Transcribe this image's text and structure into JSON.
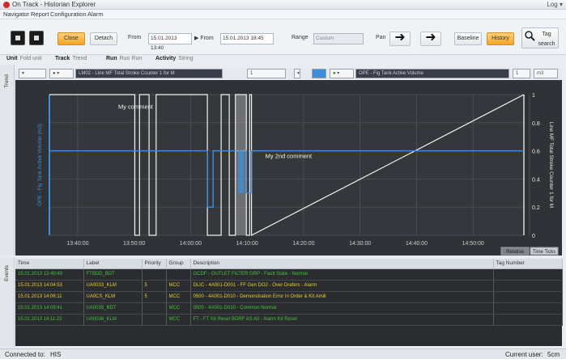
{
  "app": {
    "title": "On Track - Historian Explorer",
    "window_controls": "Log ▾"
  },
  "menu": [
    "Navigator",
    "Report",
    "Configuration",
    "Alarm"
  ],
  "toolbar": {
    "close_label": "Close",
    "detach_label": "Detach",
    "from_label": "From",
    "from_value": "15.01.2013 13:40",
    "to_label": "▶ From",
    "to_value": "15.01.2013 18:45",
    "range_label": "Range",
    "range_value": "Custom",
    "pan_label": "Pan",
    "baseline_label": "Baseline",
    "history_label": "History",
    "tag_search_label": "Tag search"
  },
  "subtoolbar": [
    {
      "label": "Unit",
      "value": "Fold unit"
    },
    {
      "label": "Track",
      "value": "Trend"
    },
    {
      "label": "Run",
      "value": "Run Run"
    },
    {
      "label": "Activity",
      "value": "String"
    }
  ],
  "strips": {
    "trend": "Trend",
    "events": "Events"
  },
  "selectors": {
    "pen1": "LM02 - Line MF Total Stroke Counter 1 for M",
    "pen1_num": "1",
    "pen2": "OPE - Fig Tank Active Volume",
    "pen2_num": "1",
    "pen2_unit": "m3"
  },
  "colors": {
    "accent": "#f4a42a",
    "series_blue": "#3d8fdc",
    "series_white": "#f2f2f2",
    "chart_bg": "#2f3236",
    "event_green": "#46c03a",
    "event_yellow": "#e6cf2a"
  },
  "chart_data": {
    "type": "line",
    "x_ticks": [
      "13:40:00",
      "13:50:00",
      "14:00:00",
      "14:10:00",
      "14:20:00",
      "14:30:00",
      "14:40:00",
      "14:50:00"
    ],
    "yleft_label": "OPE - Fig Tank Active Volume (m3)",
    "yright_label": "Line MF Total Stroke Counter 1 for M",
    "yright_ticks": [
      "1",
      "0.8",
      "0.6",
      "0.4",
      "0.2",
      "0"
    ],
    "ylim_right": [
      0,
      1
    ],
    "series": [
      {
        "name": "Line MF Total Stroke Counter 1 for M",
        "color": "#f2f2f2",
        "x": [
          0.0,
          0.18,
          0.18,
          0.19,
          0.19,
          0.21,
          0.21,
          0.225,
          0.225,
          0.333,
          0.333,
          0.362,
          0.362,
          0.379,
          0.379,
          0.392,
          0.392,
          0.415,
          0.415,
          0.422,
          0.422,
          0.426,
          0.426,
          1.0
        ],
        "values": [
          1,
          1,
          0,
          0,
          1,
          1,
          0,
          0,
          1,
          1,
          0,
          0,
          1,
          1,
          0,
          0,
          1,
          1,
          0,
          0,
          1,
          1,
          0,
          1
        ]
      },
      {
        "name": "Fig Tank Active Volume",
        "color": "#3d8fdc",
        "x": [
          0.0,
          0.333,
          0.333,
          0.345,
          0.345,
          0.415,
          0.415,
          0.425,
          0.425,
          1.0
        ],
        "values": [
          0.6,
          0.6,
          0.2,
          0.2,
          0.6,
          0.6,
          0.3,
          0.3,
          0.6,
          0.6
        ]
      }
    ],
    "annotations": [
      {
        "text": "My comment",
        "x": 0.145,
        "y": 0.9
      },
      {
        "text": "My 2nd comment",
        "x": 0.455,
        "y": 0.55
      }
    ],
    "grid": true,
    "bottom_tabs": [
      "Relative",
      "Time Ticks"
    ]
  },
  "events": {
    "columns": [
      "Time",
      "Label",
      "Priority",
      "Group",
      "Description",
      "Tag Number"
    ],
    "rows": [
      {
        "cells": [
          "15.01.2013 13:49:49",
          "FTBDD_BDT",
          "",
          "",
          "GCDF - OUTLET FILTER GRP - Fault State - Normal",
          ""
        ],
        "color": "#46c03a"
      },
      {
        "cells": [
          "15.01.2013 14:04:53",
          "UA0033_KLM",
          "5",
          "MCC",
          "DLIC - 4A001-D001 - FF Gen DO2 - Over Drafers - Alarm",
          ""
        ],
        "color": "#e6cf2a"
      },
      {
        "cells": [
          "15.01.2013 14:06:11",
          "UA0CS_KLM",
          "5",
          "MCC",
          "0500 - 4A001-D010 - Demonstration Error In Order & Kit Amill",
          ""
        ],
        "color": "#e6cf2a"
      },
      {
        "cells": [
          "15.01.2013 14:09:41",
          "UA0035_BDT",
          "",
          "MCC",
          "0500 - 4A001-D010 - Common Normal",
          ""
        ],
        "color": "#46c03a"
      },
      {
        "cells": [
          "15.01.2013 14:11:22",
          "UA0036_KLM",
          "",
          "MCC",
          "FT - FT Kit Reset BDRF AS A0 - Alarm Kit Reset",
          ""
        ],
        "color": "#46c03a"
      }
    ]
  },
  "status": {
    "connected_label": "Connected to:",
    "connected_value": "HIS",
    "current_user_label": "Current user:",
    "current_user_value": "5cm"
  }
}
